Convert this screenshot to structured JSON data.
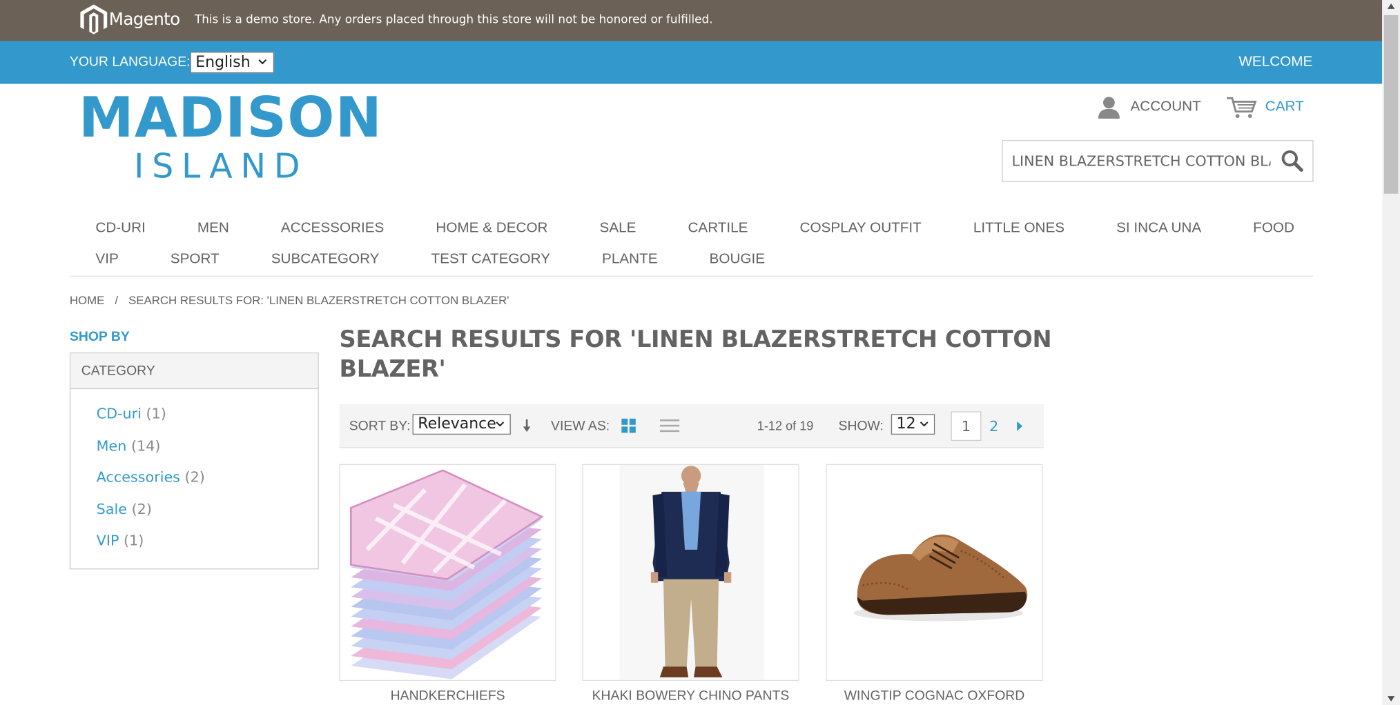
{
  "demo_notice": {
    "brand": "Magento",
    "text": "This is a demo store. Any orders placed through this store will not be honored or fulfilled."
  },
  "language_bar": {
    "label": "YOUR LANGUAGE:",
    "selected": "English",
    "welcome": "WELCOME"
  },
  "logo": {
    "line1": "MADISON",
    "line2": "ISLAND"
  },
  "header": {
    "account": "ACCOUNT",
    "cart": "CART",
    "search_value": "LINEN BLAZERSTRETCH COTTON BLAZER"
  },
  "nav": {
    "row1": [
      "CD-URI",
      "MEN",
      "ACCESSORIES",
      "HOME & DECOR",
      "SALE",
      "CARTILE",
      "COSPLAY OUTFIT",
      "LITTLE ONES",
      "SI INCA UNA",
      "FOOD"
    ],
    "row2": [
      "VIP",
      "SPORT",
      "SUBCATEGORY",
      "TEST CATEGORY",
      "PLANTE",
      "BOUGIE"
    ]
  },
  "breadcrumb": {
    "home": "HOME",
    "separator": "/",
    "current": "SEARCH RESULTS FOR: 'LINEN BLAZERSTRETCH COTTON BLAZER'"
  },
  "sidebar": {
    "shop_by": "SHOP BY",
    "category_heading": "CATEGORY",
    "categories": [
      {
        "name": "CD-uri",
        "count": "(1)"
      },
      {
        "name": "Men",
        "count": "(14)"
      },
      {
        "name": "Accessories",
        "count": "(2)"
      },
      {
        "name": "Sale",
        "count": "(2)"
      },
      {
        "name": "VIP",
        "count": "(1)"
      }
    ]
  },
  "main": {
    "title": "SEARCH RESULTS FOR 'LINEN BLAZERSTRETCH COTTON BLAZER'"
  },
  "toolbar": {
    "sort_label": "SORT BY:",
    "sort_value": "Relevance",
    "view_label": "VIEW AS:",
    "count": "1-12 of 19",
    "show_label": "SHOW:",
    "show_value": "12",
    "page_current": "1",
    "page_next_num": "2"
  },
  "products": [
    {
      "name": "HANDKERCHIEFS"
    },
    {
      "name": "KHAKI BOWERY CHINO PANTS"
    },
    {
      "name": "WINGTIP COGNAC OXFORD"
    }
  ],
  "colors": {
    "demo_bar": "#6b6157",
    "accent": "#3399cc",
    "text": "#636363"
  }
}
